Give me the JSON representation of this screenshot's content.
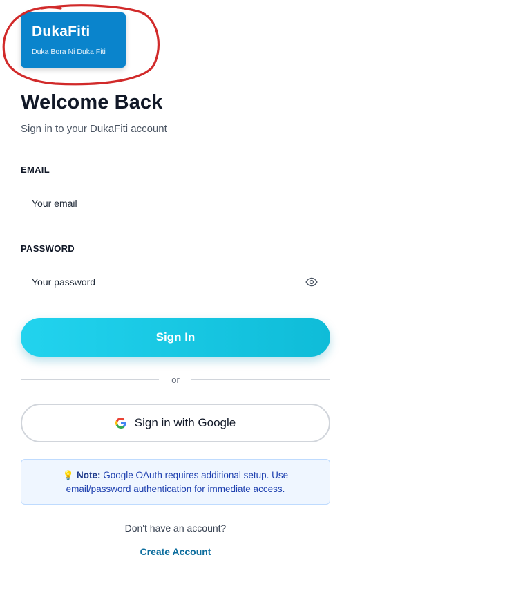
{
  "logo": {
    "title": "DukaFiti",
    "tagline": "Duka Bora Ni Duka Fiti"
  },
  "heading": "Welcome Back",
  "subheading": "Sign in to your DukaFiti account",
  "email": {
    "label": "EMAIL",
    "placeholder": "Your email",
    "value": ""
  },
  "password": {
    "label": "PASSWORD",
    "placeholder": "Your password",
    "value": "",
    "toggle_icon": "eye-icon"
  },
  "signin_button": "Sign In",
  "divider_text": "or",
  "google_button": {
    "label": "Sign in with Google",
    "icon": "google-icon"
  },
  "note": {
    "icon": "lightbulb-icon",
    "title": "Note:",
    "text": "Google OAuth requires additional setup. Use email/password authentication for immediate access."
  },
  "footer": {
    "prompt": "Don't have an account?",
    "link": "Create Account"
  },
  "colors": {
    "logo_bg": "#0a84cc",
    "primary_button": "#22d3ee",
    "annotation": "#d12a2a",
    "link": "#0e6e9e"
  }
}
